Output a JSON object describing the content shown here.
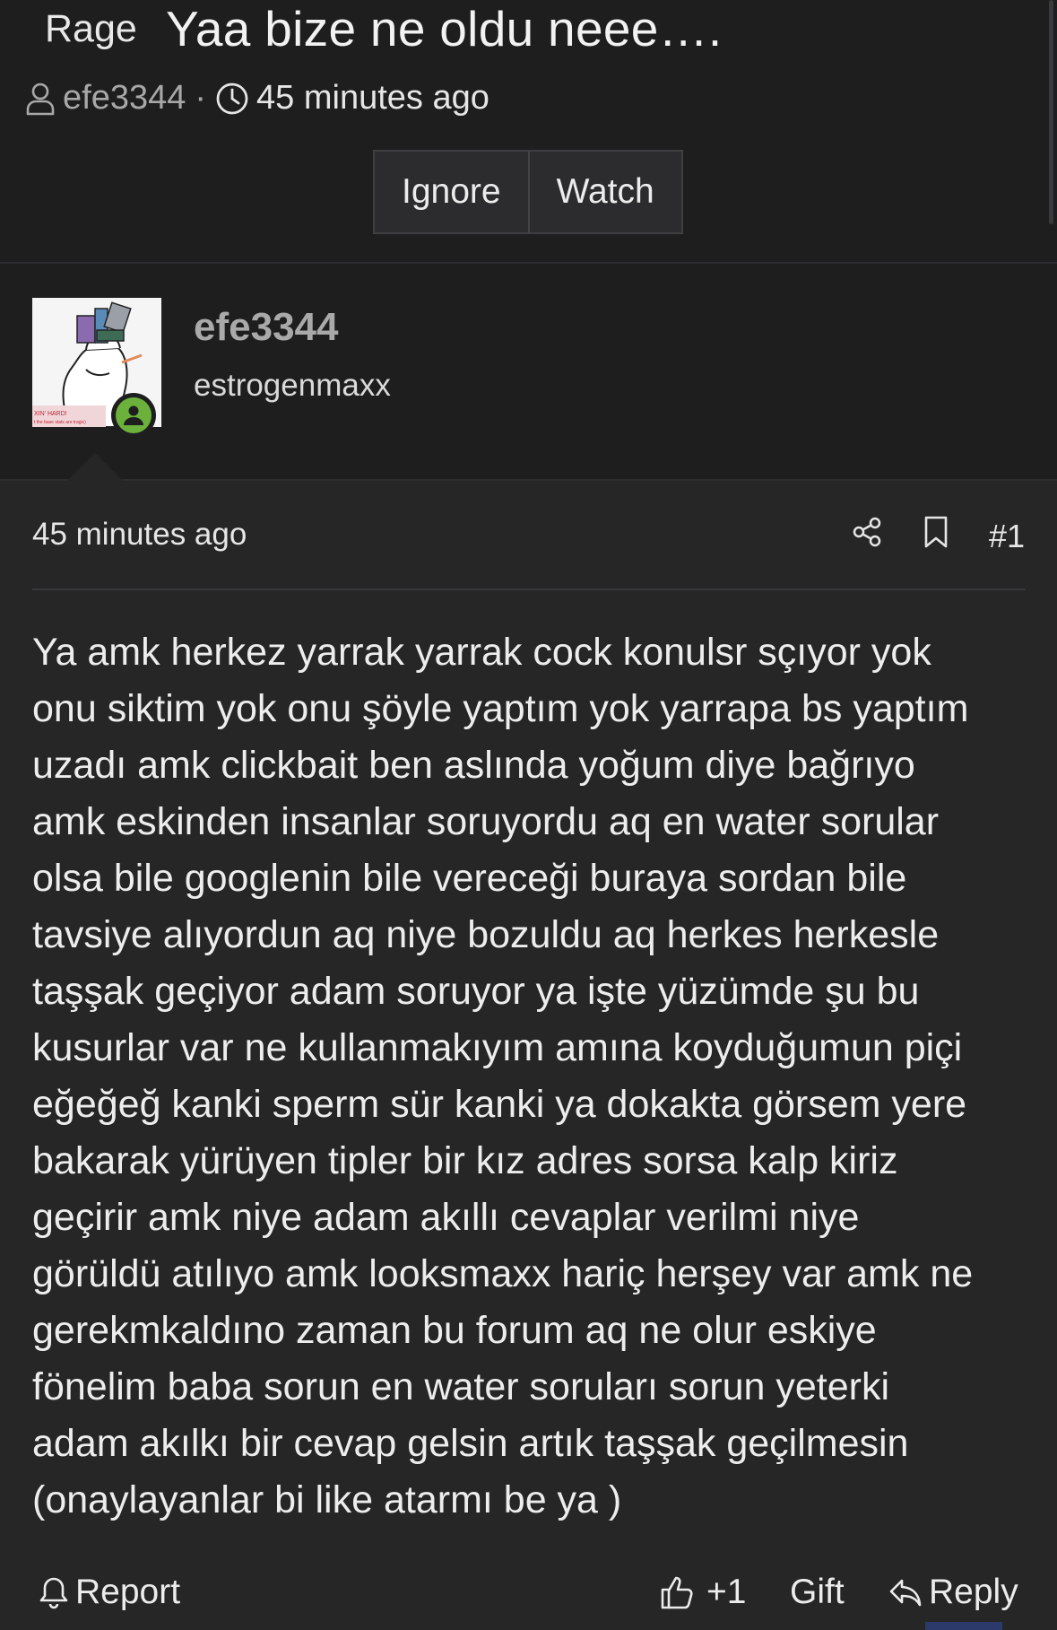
{
  "thread": {
    "prefix": "Rage",
    "title": "Yaa bize ne oldu neee….",
    "author": "efe3344",
    "separator": "·",
    "time": "45 minutes ago",
    "buttons": {
      "ignore": "Ignore",
      "watch": "Watch"
    }
  },
  "user": {
    "name": "efe3344",
    "title": "estrogenmaxx",
    "avatar_caption": "XIN' HARD!",
    "avatar_subcaption": "t the base stats are tragic)",
    "status_color": "#6bb13b"
  },
  "post": {
    "time": "45 minutes ago",
    "number": "#1",
    "lines": [
      "Ya amk herkez yarrak yarrak cock konulsr sçıyor yok",
      "onu siktim yok onu şöyle yaptım yok yarrapa bs yaptım",
      "uzadı amk clickbait ben aslında yoğum diye bağrıyo",
      "amk eskinden insanlar soruyordu aq en water sorular",
      "olsa bile googlenin bile vereceği buraya sordan bile",
      "tavsiye alıyordun aq niye bozuldu aq herkes herkesle",
      "taşşak geçiyor adam soruyor ya işte yüzümde şu bu",
      "kusurlar var ne kullanmakıyım amına koyduğumun piçi",
      "eğeğeğ kanki sperm sür kanki ya dokakta görsem yere",
      "bakarak yürüyen tipler bir kız adres sorsa kalp kiriz",
      "geçirir amk niye adam akıllı cevaplar verilmi niye",
      "görüldü atılıyo amk looksmaxx hariç herşey var amk ne",
      "gerekmkaldıno zaman bu forum aq ne olur eskiye",
      "fönelim baba sorun en water soruları sorun yeterki",
      "adam akılkı bir cevap gelsin artık taşşak geçilmesin",
      "(onaylayanlar bi like atarmı be ya )"
    ]
  },
  "footer": {
    "report": "Report",
    "like": "+1",
    "gift": "Gift",
    "reply": "Reply"
  }
}
